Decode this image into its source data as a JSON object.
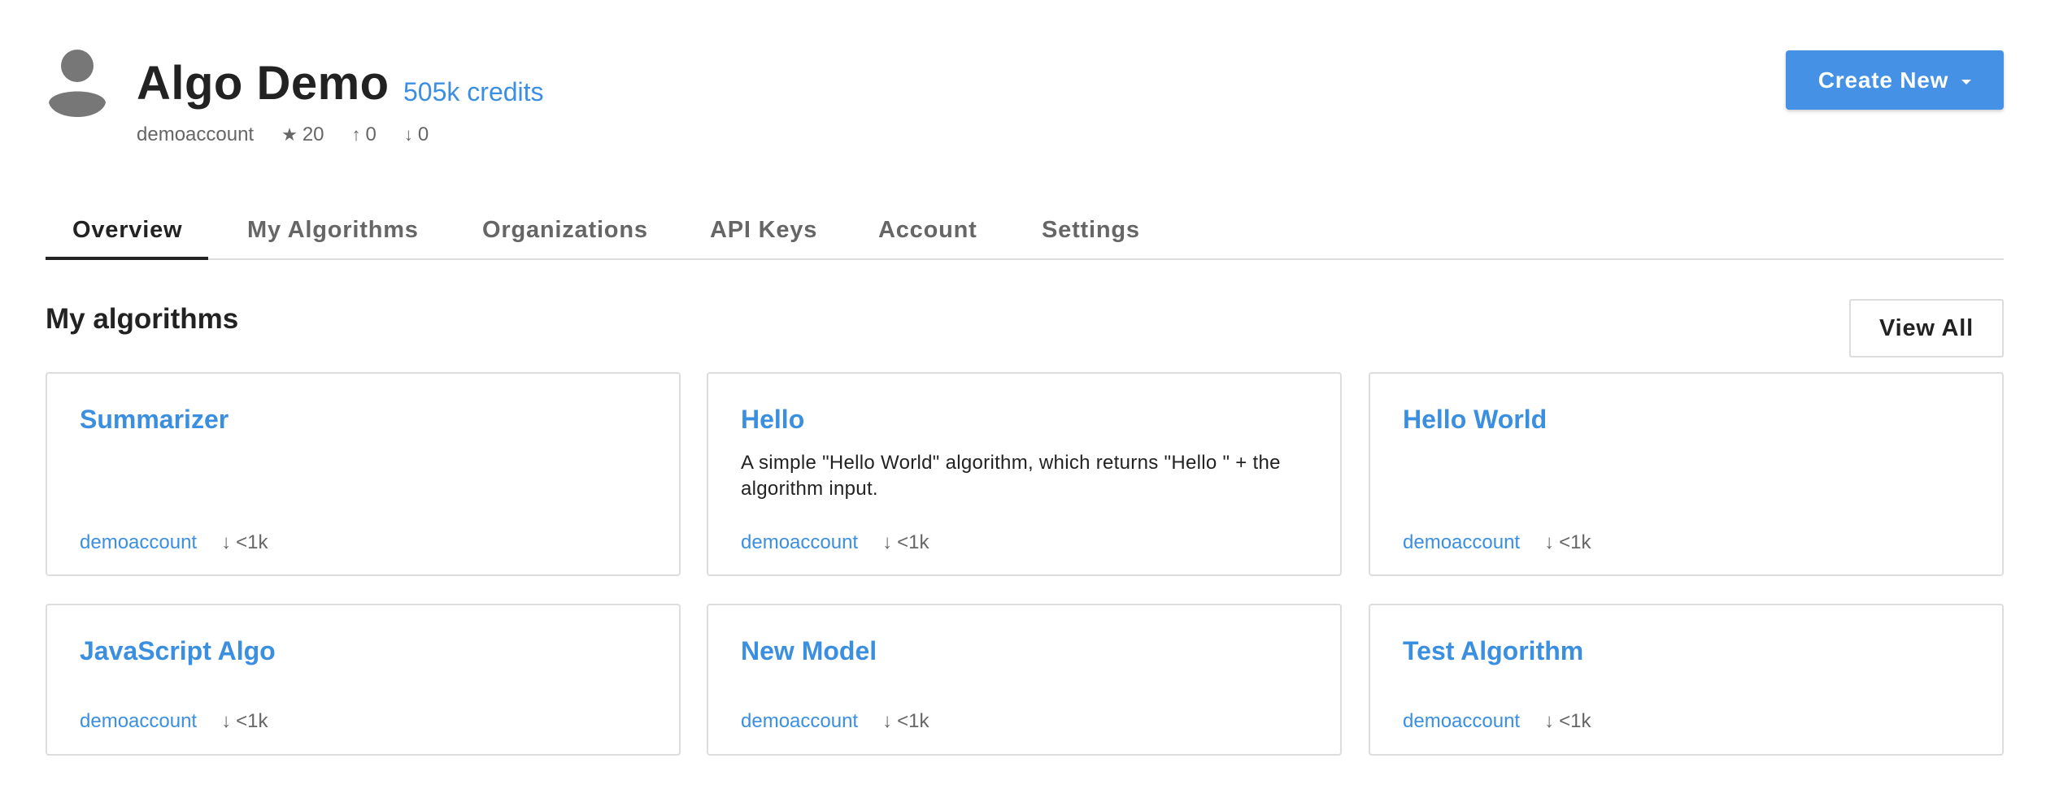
{
  "profile": {
    "name": "Algo Demo",
    "credits": "505k credits",
    "username": "demoaccount",
    "stars": "20",
    "followers": "0",
    "following": "0",
    "icons": {
      "stars": "star-icon",
      "followers": "arrow-up-icon",
      "following": "arrow-down-icon",
      "avatar": "user-avatar-icon"
    }
  },
  "header": {
    "create_label": "Create New"
  },
  "tabs": [
    {
      "label": "Overview",
      "active": true
    },
    {
      "label": "My Algorithms",
      "active": false
    },
    {
      "label": "Organizations",
      "active": false
    },
    {
      "label": "API Keys",
      "active": false
    },
    {
      "label": "Account",
      "active": false
    },
    {
      "label": "Settings",
      "active": false
    }
  ],
  "section": {
    "title": "My algorithms",
    "view_all_label": "View All"
  },
  "algorithms": [
    {
      "title": "Summarizer",
      "description": "",
      "owner": "demoaccount",
      "calls": "<1k"
    },
    {
      "title": "Hello",
      "description": "A simple \"Hello World\" algorithm, which returns \"Hello \" + the algorithm input.",
      "owner": "demoaccount",
      "calls": "<1k"
    },
    {
      "title": "Hello World",
      "description": "",
      "owner": "demoaccount",
      "calls": "<1k"
    },
    {
      "title": "JavaScript Algo",
      "description": "",
      "owner": "demoaccount",
      "calls": "<1k"
    },
    {
      "title": "New Model",
      "description": "",
      "owner": "demoaccount",
      "calls": "<1k"
    },
    {
      "title": "Test Algorithm",
      "description": "",
      "owner": "demoaccount",
      "calls": "<1k"
    }
  ],
  "colors": {
    "accent": "#4591e6",
    "link": "#3b8fe0",
    "text": "#222222",
    "muted": "#666666",
    "border": "#dddddd"
  }
}
